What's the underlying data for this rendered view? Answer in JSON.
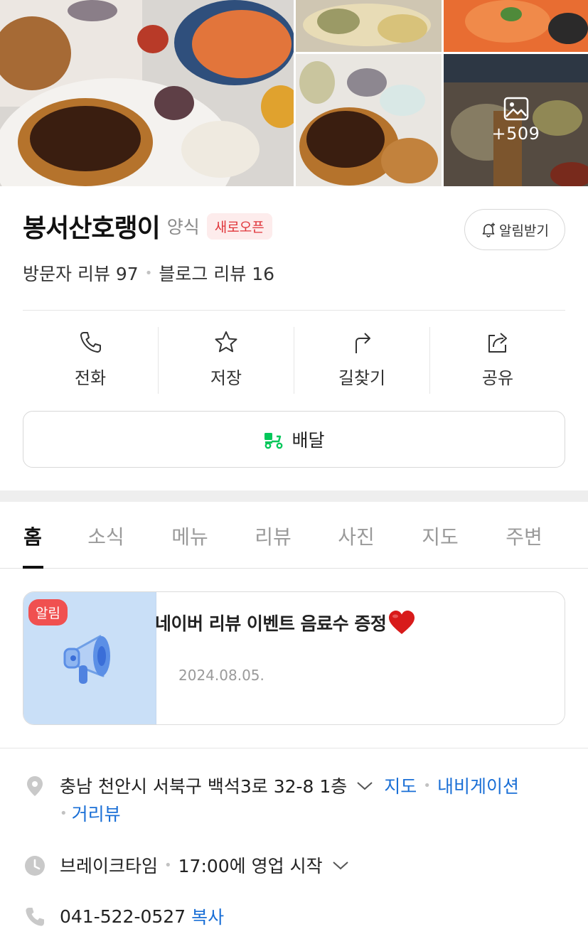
{
  "gallery": {
    "more_count": "+509",
    "image_icon": "image-icon"
  },
  "place": {
    "name": "봉서산호랭이",
    "category": "양식",
    "badge": "새로오픈",
    "alert_label": "알림받기",
    "visitor_reviews": "방문자 리뷰 97",
    "blog_reviews": "블로그 리뷰 16"
  },
  "actions": [
    {
      "label": "전화",
      "icon": "phone-icon"
    },
    {
      "label": "저장",
      "icon": "star-icon"
    },
    {
      "label": "길찾기",
      "icon": "directions-icon"
    },
    {
      "label": "공유",
      "icon": "share-icon"
    }
  ],
  "delivery": {
    "label": "배달",
    "icon": "delivery-scooter-icon",
    "icon_color": "#03c75a"
  },
  "tabs": [
    "홈",
    "소식",
    "메뉴",
    "리뷰",
    "사진",
    "지도",
    "주변"
  ],
  "active_tab": "홈",
  "notice": {
    "badge": "알림",
    "title": "네이버 리뷰 이벤트 음료수 증정",
    "emoji": "❤️",
    "date": "2024.08.05.",
    "thumb_color": "#c9dff7",
    "badge_color": "#f05050"
  },
  "info": {
    "address": "충남 천안시 서북구 백석3로 32-8 1층",
    "map_link": "지도",
    "navigation_link": "내비게이션",
    "street_view_link": "거리뷰",
    "hours_status": "브레이크타임",
    "hours_detail": "17:00에 영업 시작",
    "phone": "041-522-0527",
    "copy_label": "복사"
  },
  "colors": {
    "link": "#1a6fd6",
    "badge_text": "#e0363b",
    "badge_bg": "#fdecec"
  }
}
